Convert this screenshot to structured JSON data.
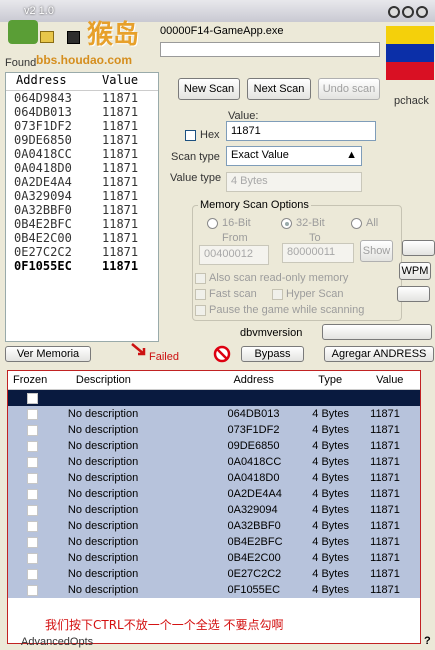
{
  "window": {
    "version": "v2 1.0",
    "process_name": "00000F14-GameApp.exe",
    "watermark": "bbs.houdao.com",
    "watermark_logo": "猴岛",
    "found_label": "Found"
  },
  "address_list": {
    "headers": {
      "address": "Address",
      "value": "Value"
    },
    "rows": [
      {
        "address": "064D9843",
        "value": "11871"
      },
      {
        "address": "064DB013",
        "value": "11871"
      },
      {
        "address": "073F1DF2",
        "value": "11871"
      },
      {
        "address": "09DE6850",
        "value": "11871"
      },
      {
        "address": "0A0418CC",
        "value": "11871"
      },
      {
        "address": "0A0418D0",
        "value": "11871"
      },
      {
        "address": "0A2DE4A4",
        "value": "11871"
      },
      {
        "address": "0A329094",
        "value": "11871"
      },
      {
        "address": "0A32BBF0",
        "value": "11871"
      },
      {
        "address": "0B4E2BFC",
        "value": "11871"
      },
      {
        "address": "0B4E2C00",
        "value": "11871"
      },
      {
        "address": "0E27C2C2",
        "value": "11871"
      },
      {
        "address": "0F1055EC",
        "value": "11871"
      }
    ]
  },
  "scan": {
    "new_scan": "New Scan",
    "next_scan": "Next Scan",
    "undo_scan": "Undo scan",
    "pchack": "pchack",
    "value_label": "Value:",
    "hex_label": "Hex",
    "value": "11871",
    "scan_type_label": "Scan type",
    "scan_type_value": "Exact Value",
    "value_type_label": "Value type",
    "value_type_value": "4 Bytes"
  },
  "memory_options": {
    "title": "Memory Scan Options",
    "bit16": "16-Bit",
    "bit32": "32-Bit",
    "all": "All",
    "from_label": "From",
    "to_label": "To",
    "from_value": "00400012",
    "to_value": "80000011",
    "show_button": "Show",
    "wpm_button": "WPM",
    "readonly_label": "Also scan read-only memory",
    "fast_scan": "Fast scan",
    "hyper_scan": "Hyper Scan",
    "pause_label": "Pause the game while scanning"
  },
  "actions": {
    "dbvm": "dbvmversion",
    "ver_memoria": "Ver Memoria",
    "failed": "Failed",
    "bypass": "Bypass",
    "agregar": "Agregar ANDRESS"
  },
  "cheat_table": {
    "headers": {
      "frozen": "Frozen",
      "description": "Description",
      "address": "Address",
      "type": "Type",
      "value": "Value"
    },
    "rows": [
      {
        "description": "",
        "address": "",
        "type": "",
        "value": ""
      },
      {
        "description": "No description",
        "address": "064DB013",
        "type": "4 Bytes",
        "value": "11871"
      },
      {
        "description": "No description",
        "address": "073F1DF2",
        "type": "4 Bytes",
        "value": "11871"
      },
      {
        "description": "No description",
        "address": "09DE6850",
        "type": "4 Bytes",
        "value": "11871"
      },
      {
        "description": "No description",
        "address": "0A0418CC",
        "type": "4 Bytes",
        "value": "11871"
      },
      {
        "description": "No description",
        "address": "0A0418D0",
        "type": "4 Bytes",
        "value": "11871"
      },
      {
        "description": "No description",
        "address": "0A2DE4A4",
        "type": "4 Bytes",
        "value": "11871"
      },
      {
        "description": "No description",
        "address": "0A329094",
        "type": "4 Bytes",
        "value": "11871"
      },
      {
        "description": "No description",
        "address": "0A32BBF0",
        "type": "4 Bytes",
        "value": "11871"
      },
      {
        "description": "No description",
        "address": "0B4E2BFC",
        "type": "4 Bytes",
        "value": "11871"
      },
      {
        "description": "No description",
        "address": "0B4E2C00",
        "type": "4 Bytes",
        "value": "11871"
      },
      {
        "description": "No description",
        "address": "0E27C2C2",
        "type": "4 Bytes",
        "value": "11871"
      },
      {
        "description": "No description",
        "address": "0F1055EC",
        "type": "4 Bytes",
        "value": "11871"
      }
    ],
    "annotation": "我们按下CTRL不放一个一个全选   不要点勾啊"
  },
  "footer": {
    "advanced": "AdvancedOpts",
    "help": "?"
  }
}
